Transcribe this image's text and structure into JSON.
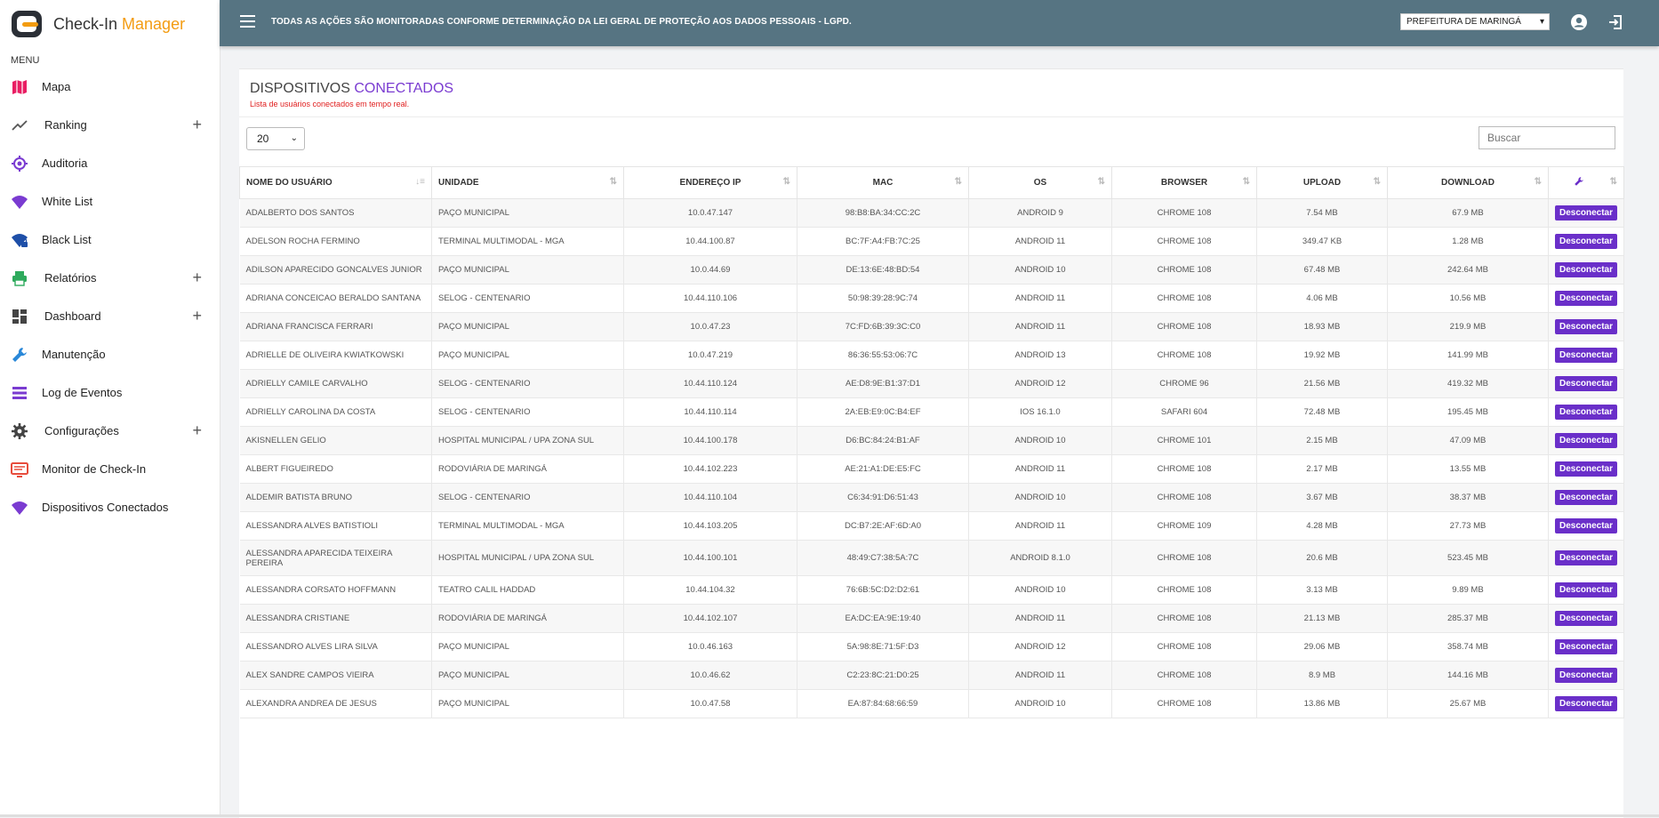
{
  "app": {
    "brand_main": "Check-In ",
    "brand_accent": "Manager"
  },
  "sidebar": {
    "menu_title": "MENU",
    "items": [
      {
        "label": "Mapa",
        "icon": "map-icon",
        "color": "#e91e63",
        "expandable": false
      },
      {
        "label": "Ranking",
        "icon": "trending-icon",
        "color": "#555555",
        "expandable": true
      },
      {
        "label": "Auditoria",
        "icon": "target-icon",
        "color": "#7a3bd1",
        "expandable": false
      },
      {
        "label": "White List",
        "icon": "wifi-icon",
        "color": "#7a3bd1",
        "expandable": false
      },
      {
        "label": "Black List",
        "icon": "wifi-lock-icon",
        "color": "#1e4fa8",
        "expandable": false
      },
      {
        "label": "Relatórios",
        "icon": "printer-icon",
        "color": "#2eaa5c",
        "expandable": true
      },
      {
        "label": "Dashboard",
        "icon": "dashboard-icon",
        "color": "#444444",
        "expandable": true
      },
      {
        "label": "Manutenção",
        "icon": "wrench-icon",
        "color": "#2a88d8",
        "expandable": false
      },
      {
        "label": "Log de Eventos",
        "icon": "list-icon",
        "color": "#7a3bd1",
        "expandable": false
      },
      {
        "label": "Configurações",
        "icon": "gear-icon",
        "color": "#444444",
        "expandable": true
      },
      {
        "label": "Monitor de Check-In",
        "icon": "monitor-icon",
        "color": "#e74c3c",
        "expandable": false
      },
      {
        "label": "Dispositivos Conectados",
        "icon": "wifi-icon",
        "color": "#7a3bd1",
        "expandable": false
      }
    ]
  },
  "topbar": {
    "notice": "TODAS AS AÇÕES SÃO MONITORADAS CONFORME DETERMINAÇÃO DA LEI GERAL DE PROTEÇÃO AOS DADOS PESSOAIS - LGPD.",
    "prefeitura": "PREFEITURA DE MARINGÁ"
  },
  "page": {
    "title_main": "DISPOSITIVOS ",
    "title_accent": "CONECTADOS",
    "subtitle": "Lista de usuários conectados em tempo real.",
    "page_size": "20",
    "search_placeholder": "Buscar"
  },
  "colors": {
    "accent": "#7a3bd1",
    "topbar": "#567482",
    "button": "#6a2fc9",
    "subtitle": "#e02020"
  },
  "table": {
    "columns": [
      "NOME DO USUÁRIO",
      "UNIDADE",
      "ENDEREÇO IP",
      "MAC",
      "OS",
      "BROWSER",
      "UPLOAD",
      "DOWNLOAD"
    ],
    "action_label": "Desconectar",
    "rows": [
      {
        "nome": "ADALBERTO DOS SANTOS",
        "unidade": "PAÇO MUNICIPAL",
        "ip": "10.0.47.147",
        "mac": "98:B8:BA:34:CC:2C",
        "os": "ANDROID 9",
        "browser": "CHROME 108",
        "upload": "7.54 MB",
        "download": "67.9 MB"
      },
      {
        "nome": "ADELSON ROCHA FERMINO",
        "unidade": "TERMINAL MULTIMODAL - MGA",
        "ip": "10.44.100.87",
        "mac": "BC:7F:A4:FB:7C:25",
        "os": "ANDROID 11",
        "browser": "CHROME 108",
        "upload": "349.47 KB",
        "download": "1.28 MB"
      },
      {
        "nome": "ADILSON APARECIDO GONCALVES JUNIOR",
        "unidade": "PAÇO MUNICIPAL",
        "ip": "10.0.44.69",
        "mac": "DE:13:6E:48:BD:54",
        "os": "ANDROID 10",
        "browser": "CHROME 108",
        "upload": "67.48 MB",
        "download": "242.64 MB"
      },
      {
        "nome": "ADRIANA CONCEICAO BERALDO SANTANA",
        "unidade": "SELOG - CENTENARIO",
        "ip": "10.44.110.106",
        "mac": "50:98:39:28:9C:74",
        "os": "ANDROID 11",
        "browser": "CHROME 108",
        "upload": "4.06 MB",
        "download": "10.56 MB"
      },
      {
        "nome": "ADRIANA FRANCISCA FERRARI",
        "unidade": "PAÇO MUNICIPAL",
        "ip": "10.0.47.23",
        "mac": "7C:FD:6B:39:3C:C0",
        "os": "ANDROID 11",
        "browser": "CHROME 108",
        "upload": "18.93 MB",
        "download": "219.9 MB"
      },
      {
        "nome": "ADRIELLE DE OLIVEIRA KWIATKOWSKI",
        "unidade": "PAÇO MUNICIPAL",
        "ip": "10.0.47.219",
        "mac": "86:36:55:53:06:7C",
        "os": "ANDROID 13",
        "browser": "CHROME 108",
        "upload": "19.92 MB",
        "download": "141.99 MB"
      },
      {
        "nome": "ADRIELLY CAMILE CARVALHO",
        "unidade": "SELOG - CENTENARIO",
        "ip": "10.44.110.124",
        "mac": "AE:D8:9E:B1:37:D1",
        "os": "ANDROID 12",
        "browser": "CHROME 96",
        "upload": "21.56 MB",
        "download": "419.32 MB"
      },
      {
        "nome": "ADRIELLY CAROLINA DA COSTA",
        "unidade": "SELOG - CENTENARIO",
        "ip": "10.44.110.114",
        "mac": "2A:EB:E9:0C:B4:EF",
        "os": "IOS 16.1.0",
        "browser": "SAFARI 604",
        "upload": "72.48 MB",
        "download": "195.45 MB"
      },
      {
        "nome": "AKISNELLEN GELIO",
        "unidade": "HOSPITAL MUNICIPAL / UPA ZONA SUL",
        "ip": "10.44.100.178",
        "mac": "D6:BC:84:24:B1:AF",
        "os": "ANDROID 10",
        "browser": "CHROME 101",
        "upload": "2.15 MB",
        "download": "47.09 MB"
      },
      {
        "nome": "ALBERT FIGUEIREDO",
        "unidade": "RODOVIÁRIA DE MARINGÁ",
        "ip": "10.44.102.223",
        "mac": "AE:21:A1:DE:E5:FC",
        "os": "ANDROID 11",
        "browser": "CHROME 108",
        "upload": "2.17 MB",
        "download": "13.55 MB"
      },
      {
        "nome": "ALDEMIR BATISTA BRUNO",
        "unidade": "SELOG - CENTENARIO",
        "ip": "10.44.110.104",
        "mac": "C6:34:91:D6:51:43",
        "os": "ANDROID 10",
        "browser": "CHROME 108",
        "upload": "3.67 MB",
        "download": "38.37 MB"
      },
      {
        "nome": "ALESSANDRA ALVES BATISTIOLI",
        "unidade": "TERMINAL MULTIMODAL - MGA",
        "ip": "10.44.103.205",
        "mac": "DC:B7:2E:AF:6D:A0",
        "os": "ANDROID 11",
        "browser": "CHROME 109",
        "upload": "4.28 MB",
        "download": "27.73 MB"
      },
      {
        "nome": "ALESSANDRA APARECIDA TEIXEIRA PEREIRA",
        "unidade": "HOSPITAL MUNICIPAL / UPA ZONA SUL",
        "ip": "10.44.100.101",
        "mac": "48:49:C7:38:5A:7C",
        "os": "ANDROID 8.1.0",
        "browser": "CHROME 108",
        "upload": "20.6 MB",
        "download": "523.45 MB",
        "tall": true
      },
      {
        "nome": "ALESSANDRA CORSATO HOFFMANN",
        "unidade": "TEATRO CALIL HADDAD",
        "ip": "10.44.104.32",
        "mac": "76:6B:5C:D2:D2:61",
        "os": "ANDROID 10",
        "browser": "CHROME 108",
        "upload": "3.13 MB",
        "download": "9.89 MB"
      },
      {
        "nome": "ALESSANDRA CRISTIANE",
        "unidade": "RODOVIÁRIA DE MARINGÁ",
        "ip": "10.44.102.107",
        "mac": "EA:DC:EA:9E:19:40",
        "os": "ANDROID 11",
        "browser": "CHROME 108",
        "upload": "21.13 MB",
        "download": "285.37 MB"
      },
      {
        "nome": "ALESSANDRO ALVES LIRA SILVA",
        "unidade": "PAÇO MUNICIPAL",
        "ip": "10.0.46.163",
        "mac": "5A:98:8E:71:5F:D3",
        "os": "ANDROID 12",
        "browser": "CHROME 108",
        "upload": "29.06 MB",
        "download": "358.74 MB"
      },
      {
        "nome": "ALEX SANDRE CAMPOS VIEIRA",
        "unidade": "PAÇO MUNICIPAL",
        "ip": "10.0.46.62",
        "mac": "C2:23:8C:21:D0:25",
        "os": "ANDROID 11",
        "browser": "CHROME 108",
        "upload": "8.9 MB",
        "download": "144.16 MB"
      },
      {
        "nome": "ALEXANDRA ANDREA DE JESUS",
        "unidade": "PAÇO MUNICIPAL",
        "ip": "10.0.47.58",
        "mac": "EA:87:84:68:66:59",
        "os": "ANDROID 10",
        "browser": "CHROME 108",
        "upload": "13.86 MB",
        "download": "25.67 MB"
      }
    ]
  }
}
